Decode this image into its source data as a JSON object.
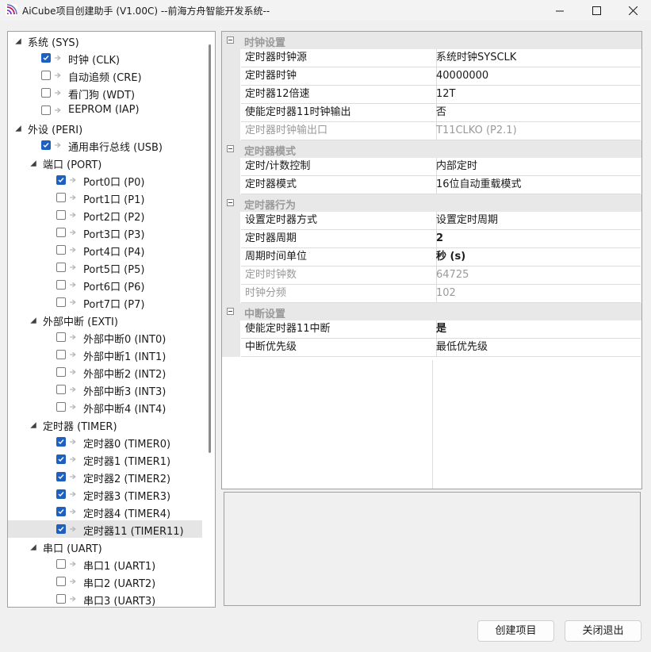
{
  "window": {
    "title": "AiCube项目创建助手 (V1.00C) --前海方舟智能开发系统--",
    "icon": "aicube-app-icon"
  },
  "tree": {
    "nodes": [
      {
        "name": "tree-node-sys",
        "label": "系统 (SYS)",
        "level": 0,
        "expander": "expanded",
        "checkbox": false,
        "checked": false
      },
      {
        "name": "tree-node-clk",
        "label": "时钟 (CLK)",
        "level": 1,
        "expander": "none",
        "checkbox": true,
        "checked": true
      },
      {
        "name": "tree-node-cre",
        "label": "自动追频 (CRE)",
        "level": 1,
        "expander": "none",
        "checkbox": true,
        "checked": false
      },
      {
        "name": "tree-node-wdt",
        "label": "看门狗 (WDT)",
        "level": 1,
        "expander": "none",
        "checkbox": true,
        "checked": false
      },
      {
        "name": "tree-node-iap",
        "label": "EEPROM (IAP)",
        "level": 1,
        "expander": "none",
        "checkbox": true,
        "checked": false
      },
      {
        "name": "tree-node-peri",
        "label": "外设 (PERI)",
        "level": 0,
        "expander": "expanded",
        "checkbox": false,
        "checked": false
      },
      {
        "name": "tree-node-usb",
        "label": "通用串行总线 (USB)",
        "level": 1,
        "expander": "none",
        "checkbox": true,
        "checked": true
      },
      {
        "name": "tree-node-port",
        "label": "端口 (PORT)",
        "level": 1,
        "expander": "expanded",
        "checkbox": false,
        "checked": false
      },
      {
        "name": "tree-node-p0",
        "label": "Port0口 (P0)",
        "level": 2,
        "expander": "none",
        "checkbox": true,
        "checked": true
      },
      {
        "name": "tree-node-p1",
        "label": "Port1口 (P1)",
        "level": 2,
        "expander": "none",
        "checkbox": true,
        "checked": false
      },
      {
        "name": "tree-node-p2",
        "label": "Port2口 (P2)",
        "level": 2,
        "expander": "none",
        "checkbox": true,
        "checked": false
      },
      {
        "name": "tree-node-p3",
        "label": "Port3口 (P3)",
        "level": 2,
        "expander": "none",
        "checkbox": true,
        "checked": false
      },
      {
        "name": "tree-node-p4",
        "label": "Port4口 (P4)",
        "level": 2,
        "expander": "none",
        "checkbox": true,
        "checked": false
      },
      {
        "name": "tree-node-p5",
        "label": "Port5口 (P5)",
        "level": 2,
        "expander": "none",
        "checkbox": true,
        "checked": false
      },
      {
        "name": "tree-node-p6",
        "label": "Port6口 (P6)",
        "level": 2,
        "expander": "none",
        "checkbox": true,
        "checked": false
      },
      {
        "name": "tree-node-p7",
        "label": "Port7口 (P7)",
        "level": 2,
        "expander": "none",
        "checkbox": true,
        "checked": false
      },
      {
        "name": "tree-node-exti",
        "label": "外部中断 (EXTI)",
        "level": 1,
        "expander": "expanded",
        "checkbox": false,
        "checked": false
      },
      {
        "name": "tree-node-int0",
        "label": "外部中断0 (INT0)",
        "level": 2,
        "expander": "none",
        "checkbox": true,
        "checked": false
      },
      {
        "name": "tree-node-int1",
        "label": "外部中断1 (INT1)",
        "level": 2,
        "expander": "none",
        "checkbox": true,
        "checked": false
      },
      {
        "name": "tree-node-int2",
        "label": "外部中断2 (INT2)",
        "level": 2,
        "expander": "none",
        "checkbox": true,
        "checked": false
      },
      {
        "name": "tree-node-int3",
        "label": "外部中断3 (INT3)",
        "level": 2,
        "expander": "none",
        "checkbox": true,
        "checked": false
      },
      {
        "name": "tree-node-int4",
        "label": "外部中断4 (INT4)",
        "level": 2,
        "expander": "none",
        "checkbox": true,
        "checked": false
      },
      {
        "name": "tree-node-timer",
        "label": "定时器 (TIMER)",
        "level": 1,
        "expander": "expanded",
        "checkbox": false,
        "checked": false
      },
      {
        "name": "tree-node-timer0",
        "label": "定时器0 (TIMER0)",
        "level": 2,
        "expander": "none",
        "checkbox": true,
        "checked": true
      },
      {
        "name": "tree-node-timer1",
        "label": "定时器1 (TIMER1)",
        "level": 2,
        "expander": "none",
        "checkbox": true,
        "checked": true
      },
      {
        "name": "tree-node-timer2",
        "label": "定时器2 (TIMER2)",
        "level": 2,
        "expander": "none",
        "checkbox": true,
        "checked": true
      },
      {
        "name": "tree-node-timer3",
        "label": "定时器3 (TIMER3)",
        "level": 2,
        "expander": "none",
        "checkbox": true,
        "checked": true
      },
      {
        "name": "tree-node-timer4",
        "label": "定时器4 (TIMER4)",
        "level": 2,
        "expander": "none",
        "checkbox": true,
        "checked": true
      },
      {
        "name": "tree-node-timer11",
        "label": "定时器11 (TIMER11)",
        "level": 2,
        "expander": "none",
        "checkbox": true,
        "checked": true,
        "selected": true
      },
      {
        "name": "tree-node-uart",
        "label": "串口 (UART)",
        "level": 1,
        "expander": "expanded",
        "checkbox": false,
        "checked": false
      },
      {
        "name": "tree-node-uart1",
        "label": "串口1 (UART1)",
        "level": 2,
        "expander": "none",
        "checkbox": true,
        "checked": false
      },
      {
        "name": "tree-node-uart2",
        "label": "串口2 (UART2)",
        "level": 2,
        "expander": "none",
        "checkbox": true,
        "checked": false
      },
      {
        "name": "tree-node-uart3",
        "label": "串口3 (UART3)",
        "level": 2,
        "expander": "none",
        "checkbox": true,
        "checked": false
      }
    ]
  },
  "properties": {
    "sections": [
      {
        "title": "时钟设置",
        "rows": [
          {
            "name": "定时器时钟源",
            "value": "系统时钟SYSCLK"
          },
          {
            "name": "定时器时钟",
            "value": "40000000"
          },
          {
            "name": "定时器12倍速",
            "value": "12T"
          },
          {
            "name": "使能定时器11时钟输出",
            "value": "否"
          },
          {
            "name": "定时器时钟输出口",
            "value": "T11CLKO (P2.1)",
            "disabled": true
          }
        ]
      },
      {
        "title": "定时器模式",
        "rows": [
          {
            "name": "定时/计数控制",
            "value": "内部定时"
          },
          {
            "name": "定时器模式",
            "value": "16位自动重载模式"
          }
        ]
      },
      {
        "title": "定时器行为",
        "rows": [
          {
            "name": "设置定时器方式",
            "value": "设置定时周期"
          },
          {
            "name": "定时器周期",
            "value": "2",
            "bold": true
          },
          {
            "name": "周期时间单位",
            "value": "秒 (s)",
            "bold": true
          },
          {
            "name": "定时时钟数",
            "value": "64725",
            "disabled": true
          },
          {
            "name": "时钟分频",
            "value": "102",
            "disabled": true
          }
        ]
      },
      {
        "title": "中断设置",
        "rows": [
          {
            "name": "使能定时器11中断",
            "value": "是",
            "bold": true
          },
          {
            "name": "中断优先级",
            "value": "最低优先级"
          }
        ]
      }
    ]
  },
  "buttons": {
    "create": "创建项目",
    "close": "关闭退出"
  },
  "colors": {
    "accent": "#1e5fbf",
    "category_bg": "#e8e8e8",
    "disabled_text": "#9a9a9a",
    "selected_row": "#e5e5e5"
  }
}
